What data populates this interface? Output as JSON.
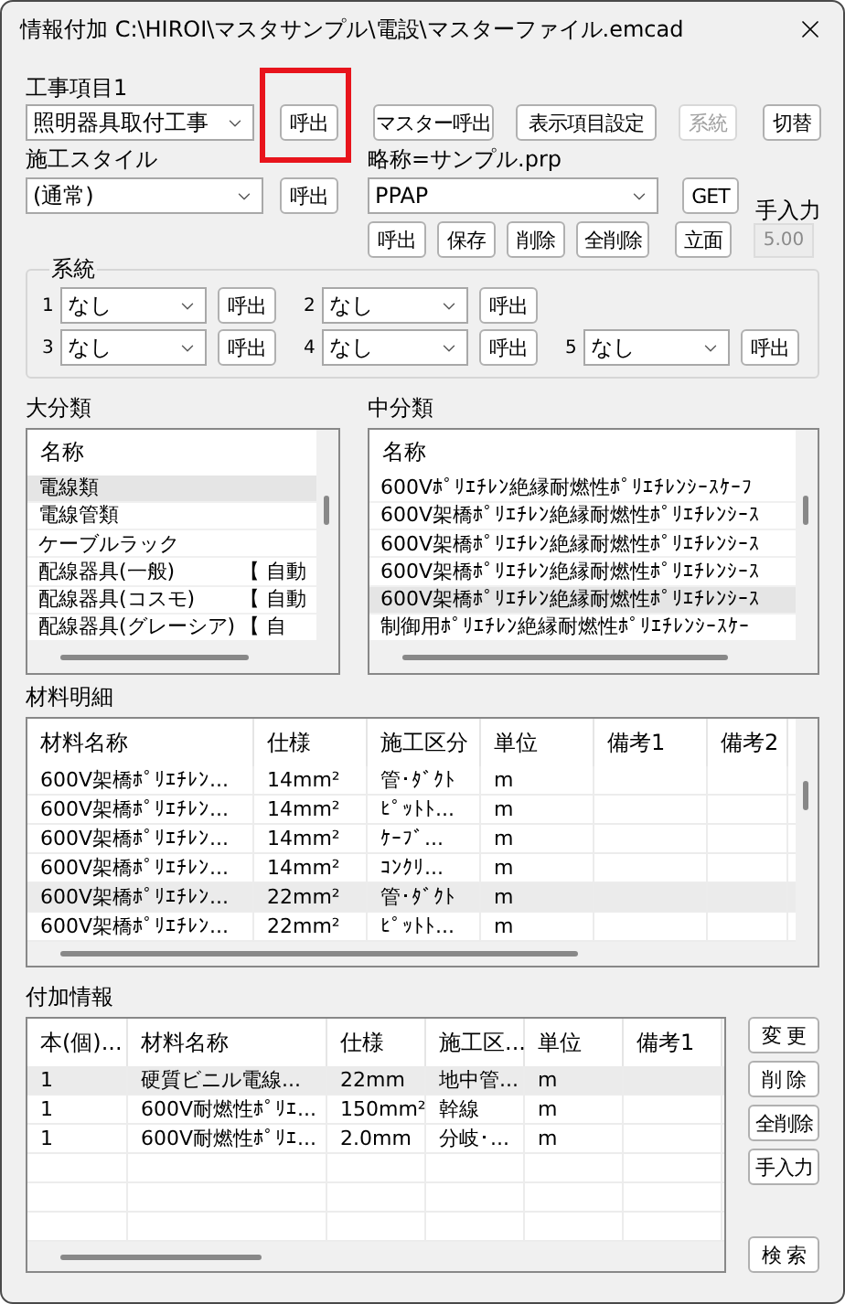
{
  "window": {
    "title": "情報付加 C:\\HIROI\\マスタサンプル\\電設\\マスターファイル.emcad"
  },
  "work_item": {
    "label": "工事項目1",
    "value": "照明器具取付工事",
    "call_button": "呼出",
    "highlighted": true
  },
  "toolbar_buttons": [
    {
      "label": "マスター呼出",
      "disabled": false
    },
    {
      "label": "表示項目設定",
      "disabled": false
    },
    {
      "label": "系統",
      "disabled": true
    },
    {
      "label": "切替",
      "disabled": false
    }
  ],
  "construction_style": {
    "label": "施工スタイル",
    "value": "(通常)",
    "call_button": "呼出"
  },
  "abbreviation": {
    "label": "略称=サンプル.prp",
    "value": "PPAP",
    "get_button": "GET",
    "buttons": [
      "呼出",
      "保存",
      "削除",
      "全削除"
    ],
    "elevation_button": "立面"
  },
  "manual_input": {
    "label": "手入力",
    "value": "5.00",
    "disabled": true
  },
  "system_group": {
    "title": "系統",
    "rows": [
      [
        {
          "number": "1",
          "value": "なし",
          "button": "呼出"
        },
        {
          "number": "2",
          "value": "なし",
          "button": "呼出"
        }
      ],
      [
        {
          "number": "3",
          "value": "なし",
          "button": "呼出"
        },
        {
          "number": "4",
          "value": "なし",
          "button": "呼出"
        },
        {
          "number": "5",
          "value": "なし",
          "button": "呼出"
        }
      ]
    ]
  },
  "major_category": {
    "title": "大分類",
    "column": "名称",
    "items": [
      {
        "name": "電線類",
        "selected": true
      },
      {
        "name": "電線管類",
        "selected": false
      },
      {
        "name": "ケーブルラック",
        "selected": false
      },
      {
        "name": "配線器具(一般)",
        "tag": "【 自動",
        "selected": false
      },
      {
        "name": "配線器具(コスモ)",
        "tag": "【 自動",
        "selected": false
      },
      {
        "name": "配線器具(グレーシア)",
        "tag": "【 自",
        "selected": false
      }
    ]
  },
  "middle_category": {
    "title": "中分類",
    "column": "名称",
    "items": [
      {
        "name": "600Vﾎﾟﾘｴﾁﾚﾝ絶縁耐燃性ﾎﾟﾘｴﾁﾚﾝｼｰｽｹｰﾌ",
        "selected": false
      },
      {
        "name": "600V架橋ﾎﾟﾘｴﾁﾚﾝ絶縁耐燃性ﾎﾟﾘｴﾁﾚﾝｼｰｽ",
        "selected": false
      },
      {
        "name": "600V架橋ﾎﾟﾘｴﾁﾚﾝ絶縁耐燃性ﾎﾟﾘｴﾁﾚﾝｼｰｽ",
        "selected": false
      },
      {
        "name": "600V架橋ﾎﾟﾘｴﾁﾚﾝ絶縁耐燃性ﾎﾟﾘｴﾁﾚﾝｼｰｽ",
        "selected": false
      },
      {
        "name": "600V架橋ﾎﾟﾘｴﾁﾚﾝ絶縁耐燃性ﾎﾟﾘｴﾁﾚﾝｼｰｽ",
        "selected": true
      },
      {
        "name": "制御用ﾎﾟﾘｴﾁﾚﾝ絶縁耐燃性ﾎﾟﾘｴﾁﾚﾝｼｰｽｹｰ",
        "selected": false
      }
    ]
  },
  "material_details": {
    "title": "材料明細",
    "columns": [
      "材料名称",
      "仕様",
      "施工区分",
      "単位",
      "備考1",
      "備考2"
    ],
    "rows": [
      {
        "cells": [
          "600V架橋ﾎﾟﾘｴﾁﾚﾝ...",
          "14mm²",
          "管･ﾀﾞｸﾄ",
          "m"
        ],
        "selected": false
      },
      {
        "cells": [
          "600V架橋ﾎﾟﾘｴﾁﾚﾝ...",
          "14mm²",
          "ﾋﾟｯﾄﾄ...",
          "m"
        ],
        "selected": false
      },
      {
        "cells": [
          "600V架橋ﾎﾟﾘｴﾁﾚﾝ...",
          "14mm²",
          "ｹｰﾌﾞ...",
          "m"
        ],
        "selected": false
      },
      {
        "cells": [
          "600V架橋ﾎﾟﾘｴﾁﾚﾝ...",
          "14mm²",
          "ｺﾝｸﾘ...",
          "m"
        ],
        "selected": false
      },
      {
        "cells": [
          "600V架橋ﾎﾟﾘｴﾁﾚﾝ...",
          "22mm²",
          "管･ﾀﾞｸﾄ",
          "m"
        ],
        "selected": true
      },
      {
        "cells": [
          "600V架橋ﾎﾟﾘｴﾁﾚﾝ...",
          "22mm²",
          "ﾋﾟｯﾄﾄ...",
          "m"
        ],
        "selected": false
      }
    ]
  },
  "additional_info": {
    "title": "付加情報",
    "columns": [
      "本(個)...",
      "材料名称",
      "仕様",
      "施工区...",
      "単位",
      "備考1"
    ],
    "rows": [
      {
        "cells": [
          "1",
          "硬質ビニル電線...",
          "22mm",
          "地中管...",
          "m"
        ],
        "selected": true
      },
      {
        "cells": [
          "1",
          "600V耐燃性ﾎﾟﾘｴ...",
          "150mm²",
          "幹線",
          "m"
        ],
        "selected": false
      },
      {
        "cells": [
          "1",
          "600V耐燃性ﾎﾟﾘｴ...",
          "2.0mm",
          "分岐･...",
          "m"
        ],
        "selected": false
      }
    ],
    "side_buttons": [
      "変 更",
      "削 除",
      "全削除",
      "手入力"
    ],
    "search_button": "検 索"
  }
}
